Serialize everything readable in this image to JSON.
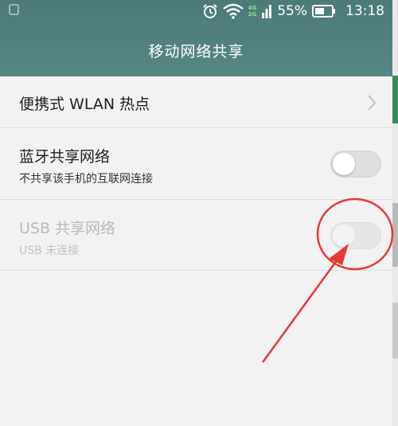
{
  "status_bar": {
    "left_icon": "notification-icon",
    "icons": [
      "alarm-icon",
      "wifi-icon",
      "signal-icon",
      "battery-icon"
    ],
    "network_badge_top": "4G",
    "network_badge_bottom": "2G",
    "battery_percent": "55%",
    "time": "13:18"
  },
  "header": {
    "title": "移动网络共享"
  },
  "rows": [
    {
      "label": "便携式 WLAN 热点",
      "type": "link",
      "icon": "chevron-right-icon"
    },
    {
      "label": "蓝牙共享网络",
      "sub": "不共享该手机的互联网连接",
      "type": "toggle",
      "checked": false,
      "enabled": true
    },
    {
      "label": "USB 共享网络",
      "sub": "USB 未连接",
      "type": "toggle",
      "checked": false,
      "enabled": false
    }
  ],
  "annotation": {
    "color": "#e53935",
    "shapes": [
      "circle-highlight",
      "arrow"
    ]
  }
}
